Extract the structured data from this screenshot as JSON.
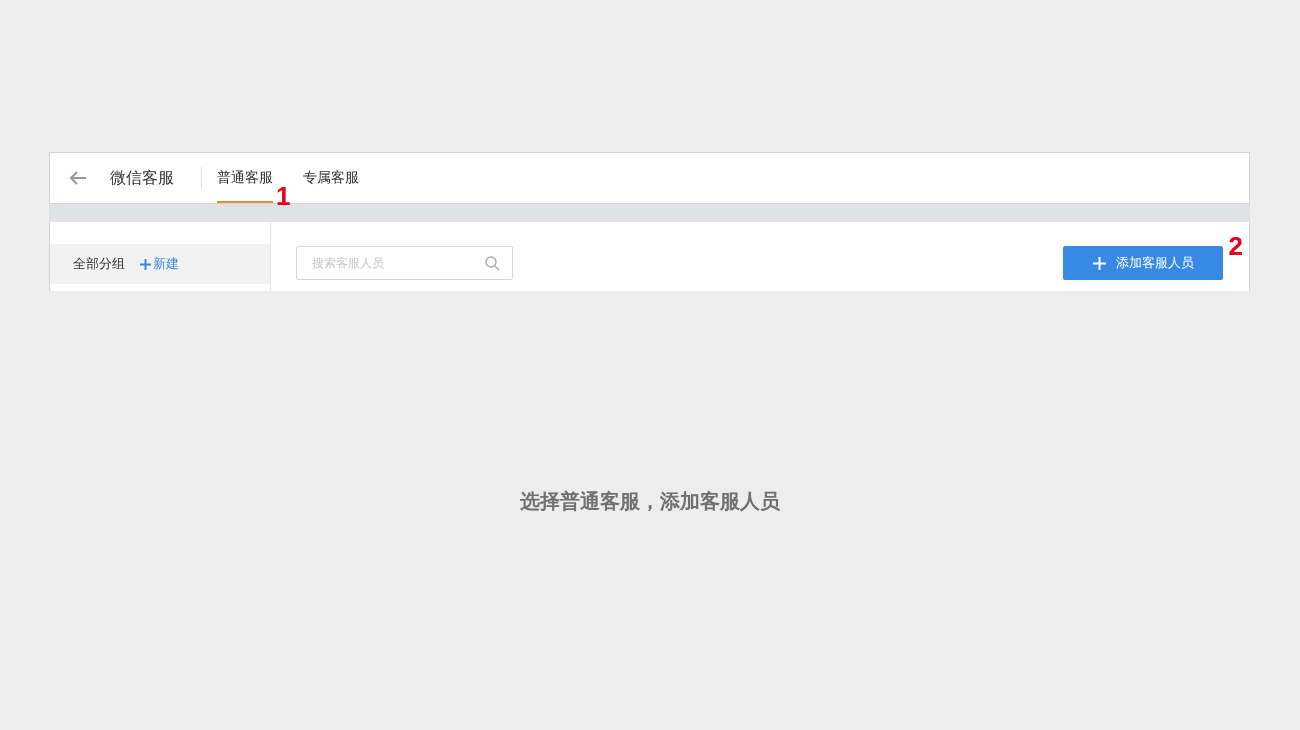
{
  "header": {
    "title": "微信客服",
    "tabs": [
      {
        "label": "普通客服",
        "selected": true
      },
      {
        "label": "专属客服",
        "selected": false
      }
    ]
  },
  "sidebar": {
    "group_label": "全部分组",
    "new_link": "新建"
  },
  "search": {
    "placeholder": "搜索客服人员"
  },
  "add_button": "添加客服人员",
  "annotations": [
    "1",
    "2"
  ],
  "caption": "选择普通客服，添加客服人员"
}
